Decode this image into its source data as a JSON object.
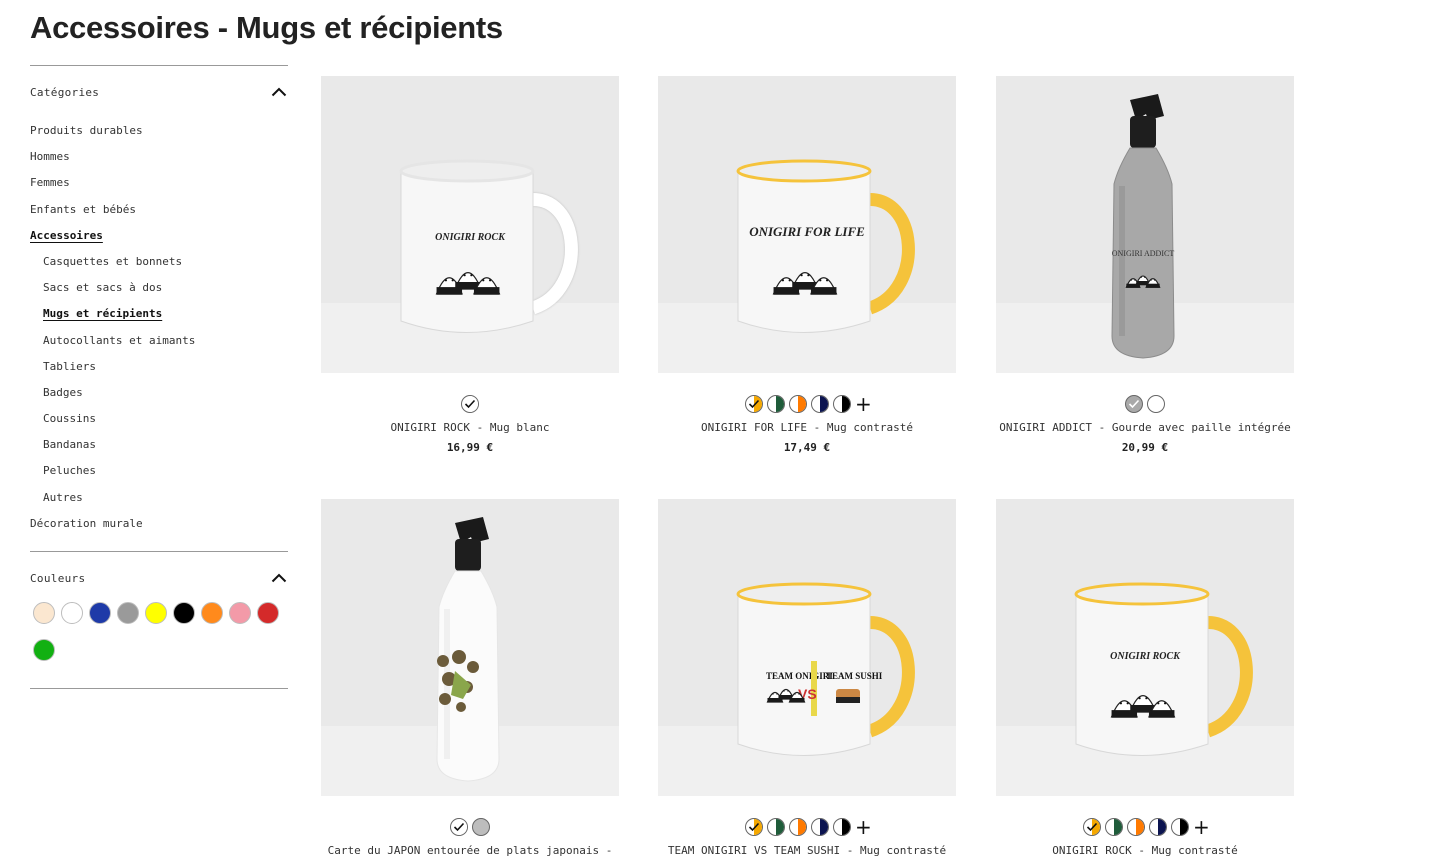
{
  "page": {
    "title": "Accessoires - Mugs et récipients"
  },
  "sidebar": {
    "categories_label": "Catégories",
    "categories": [
      {
        "label": "Produits durables",
        "level": 0,
        "active": false
      },
      {
        "label": "Hommes",
        "level": 0,
        "active": false
      },
      {
        "label": "Femmes",
        "level": 0,
        "active": false
      },
      {
        "label": "Enfants et bébés",
        "level": 0,
        "active": false
      },
      {
        "label": "Accessoires",
        "level": 0,
        "active": true
      },
      {
        "label": "Casquettes et bonnets",
        "level": 1,
        "active": false
      },
      {
        "label": "Sacs et sacs à dos",
        "level": 1,
        "active": false
      },
      {
        "label": "Mugs et récipients",
        "level": 1,
        "active": true
      },
      {
        "label": "Autocollants et aimants",
        "level": 1,
        "active": false
      },
      {
        "label": "Tabliers",
        "level": 1,
        "active": false
      },
      {
        "label": "Badges",
        "level": 1,
        "active": false
      },
      {
        "label": "Coussins",
        "level": 1,
        "active": false
      },
      {
        "label": "Bandanas",
        "level": 1,
        "active": false
      },
      {
        "label": "Peluches",
        "level": 1,
        "active": false
      },
      {
        "label": "Autres",
        "level": 1,
        "active": false
      },
      {
        "label": "Décoration murale",
        "level": 0,
        "active": false
      }
    ],
    "colors_label": "Couleurs",
    "colors": [
      "#fbe7d0",
      "#ffffff",
      "#1e3aa8",
      "#9a9a9a",
      "#ffff00",
      "#000000",
      "#ff8a1c",
      "#f39aa8",
      "#d42a2a",
      "#12b012"
    ]
  },
  "products": [
    {
      "name": "ONIGIRI ROCK - Mug blanc",
      "price": "16,99 €",
      "kind": "mug",
      "handle": "#ffffff",
      "print": "ONIGIRI ROCK",
      "colors": [
        {
          "c": "#ffffff",
          "style": "half",
          "selected": true
        }
      ],
      "more": false
    },
    {
      "name": "ONIGIRI FOR LIFE - Mug contrasté",
      "price": "17,49 €",
      "kind": "mug",
      "handle": "#f5c33b",
      "print": "ONIGIRI FOR LIFE",
      "colors": [
        {
          "c": "#f5a800",
          "style": "half",
          "selected": true
        },
        {
          "c": "#1f5c3a",
          "style": "half",
          "selected": false
        },
        {
          "c": "#ff7a00",
          "style": "half",
          "selected": false
        },
        {
          "c": "#0c1450",
          "style": "half",
          "selected": false
        },
        {
          "c": "#000000",
          "style": "half",
          "selected": false
        }
      ],
      "more": true
    },
    {
      "name": "ONIGIRI ADDICT - Gourde avec paille intégrée",
      "price": "20,99 €",
      "kind": "bottle",
      "handle": "#a9a9a9",
      "print": "ONIGIRI ADDICT",
      "colors": [
        {
          "c": "#a9a9a9",
          "style": "full",
          "selected": true
        },
        {
          "c": "#ffffff",
          "style": "full",
          "selected": false
        }
      ],
      "more": false
    },
    {
      "name": "Carte du JAPON entourée de plats japonais -",
      "price": "",
      "kind": "bottle",
      "handle": "#ffffff",
      "print": "",
      "colors": [
        {
          "c": "#ffffff",
          "style": "half",
          "selected": true
        },
        {
          "c": "#bdbdbd",
          "style": "full",
          "selected": false
        }
      ],
      "more": false
    },
    {
      "name": "TEAM ONIGIRI VS TEAM SUSHI - Mug contrasté",
      "price": "",
      "kind": "mug",
      "handle": "#f5c33b",
      "print": "TEAM ONIGIRI VS TEAM SUSHI",
      "colors": [
        {
          "c": "#f5a800",
          "style": "half",
          "selected": true
        },
        {
          "c": "#1f5c3a",
          "style": "half",
          "selected": false
        },
        {
          "c": "#ff7a00",
          "style": "half",
          "selected": false
        },
        {
          "c": "#0c1450",
          "style": "half",
          "selected": false
        },
        {
          "c": "#000000",
          "style": "half",
          "selected": false
        }
      ],
      "more": true
    },
    {
      "name": "ONIGIRI ROCK - Mug contrasté",
      "price": "",
      "kind": "mug",
      "handle": "#f5c33b",
      "print": "ONIGIRI ROCK",
      "colors": [
        {
          "c": "#f5a800",
          "style": "half",
          "selected": true
        },
        {
          "c": "#1f5c3a",
          "style": "half",
          "selected": false
        },
        {
          "c": "#ff7a00",
          "style": "half",
          "selected": false
        },
        {
          "c": "#0c1450",
          "style": "half",
          "selected": false
        },
        {
          "c": "#000000",
          "style": "half",
          "selected": false
        }
      ],
      "more": true
    }
  ]
}
